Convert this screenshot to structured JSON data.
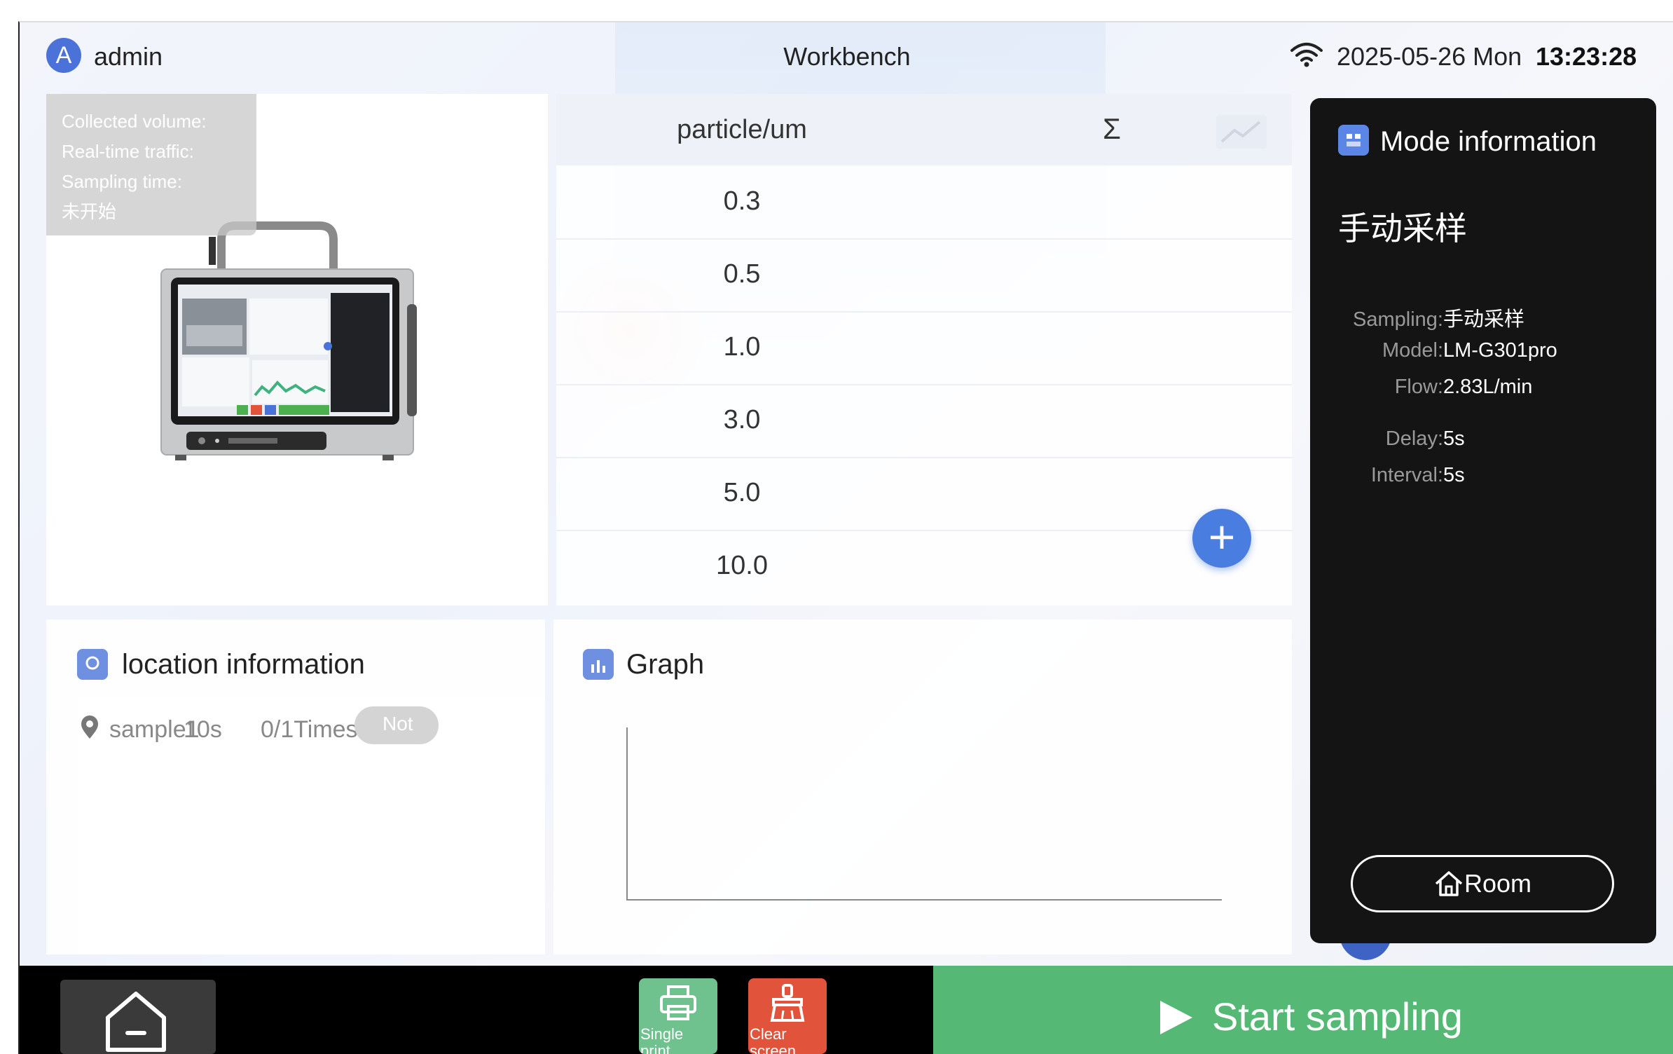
{
  "header": {
    "avatar_letter": "A",
    "user": "admin",
    "title": "Workbench",
    "date": "2025-05-26 Mon",
    "time": "13:23:28"
  },
  "device": {
    "collected_volume_label": "Collected volume:",
    "realtime_traffic_label": "Real-time traffic:",
    "sampling_time_label": "Sampling time:",
    "status": "未开始"
  },
  "particle_table": {
    "col_size": "particle/um",
    "col_sum": "Σ",
    "rows": [
      "0.3",
      "0.5",
      "1.0",
      "3.0",
      "5.0",
      "10.0"
    ],
    "add_label": "+"
  },
  "location": {
    "title": "location information",
    "items": [
      {
        "name": "sample1",
        "duration": "10s",
        "times": "0/1Times",
        "status": "Not"
      }
    ]
  },
  "graph": {
    "title": "Graph"
  },
  "mode": {
    "title": "Mode information",
    "name": "手动采样",
    "sampling_label": "Sampling:",
    "sampling_value": "手动采样",
    "model_label": "Model:",
    "model_value": "LM-G301pro",
    "flow_label": "Flow:",
    "flow_value": "2.83L/min",
    "delay_label": "Delay:",
    "delay_value": "5s",
    "interval_label": "Interval:",
    "interval_value": "5s",
    "room_label": "Room"
  },
  "bottom": {
    "single_print_label": "Single print",
    "clear_screen_label": "Clear screen",
    "start_label": "Start sampling"
  },
  "colors": {
    "accent": "#4a7de0",
    "start_green": "#55b874",
    "print_green": "#6fc18e",
    "clear_red": "#e2533c",
    "mode_bg": "#141414"
  }
}
